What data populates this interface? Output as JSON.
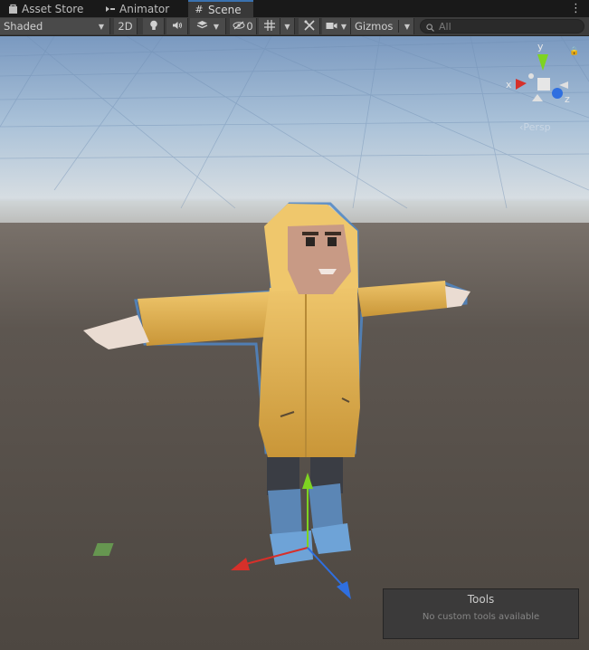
{
  "tabs": [
    {
      "label": "Asset Store",
      "icon": "bag-icon"
    },
    {
      "label": "Animator",
      "icon": "animator-icon"
    },
    {
      "label": "Scene",
      "icon": "grid-hash-icon",
      "active": true
    }
  ],
  "toolbar": {
    "draw_mode": "Shaded",
    "mode_2d": "2D",
    "hidden_count": "0",
    "gizmos": "Gizmos"
  },
  "search": {
    "placeholder": "All"
  },
  "gizmo": {
    "x_label": "x",
    "y_label": "y",
    "z_label": "z",
    "projection": "Persp"
  },
  "tools_overlay": {
    "title": "Tools",
    "message": "No custom tools available"
  },
  "colors": {
    "accent": "#3a72b0",
    "x_axis": "#d6302a",
    "y_axis": "#7ed321",
    "z_axis": "#2f6fe0",
    "coat": "#e8b84d"
  }
}
